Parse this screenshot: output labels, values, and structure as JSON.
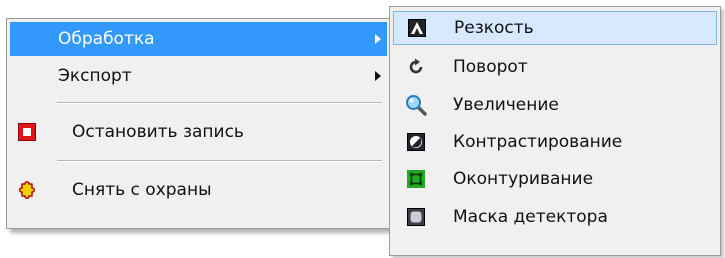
{
  "main_menu": {
    "items": [
      {
        "label": "Обработка",
        "icon": "none",
        "has_submenu": true,
        "highlighted": true
      },
      {
        "label": "Экспорт",
        "icon": "none",
        "has_submenu": true
      },
      {
        "label": "Остановить запись",
        "icon": "stop-record-icon"
      },
      {
        "label": "Снять с охраны",
        "icon": "disarm-puzzle-icon"
      }
    ]
  },
  "sub_menu": {
    "items": [
      {
        "label": "Резкость",
        "icon": "sharpness-icon",
        "selected": true
      },
      {
        "label": "Поворот",
        "icon": "rotate-icon"
      },
      {
        "label": "Увеличение",
        "icon": "zoom-magnifier-icon"
      },
      {
        "label": "Контрастирование",
        "icon": "contrast-icon"
      },
      {
        "label": "Оконтуривание",
        "icon": "contour-icon"
      },
      {
        "label": "Маска детектора",
        "icon": "detector-mask-icon"
      }
    ]
  },
  "colors": {
    "highlight": "#3399ff",
    "menu_background": "#f0f0f0",
    "selected_icon_frame": "#7eb4ea"
  }
}
